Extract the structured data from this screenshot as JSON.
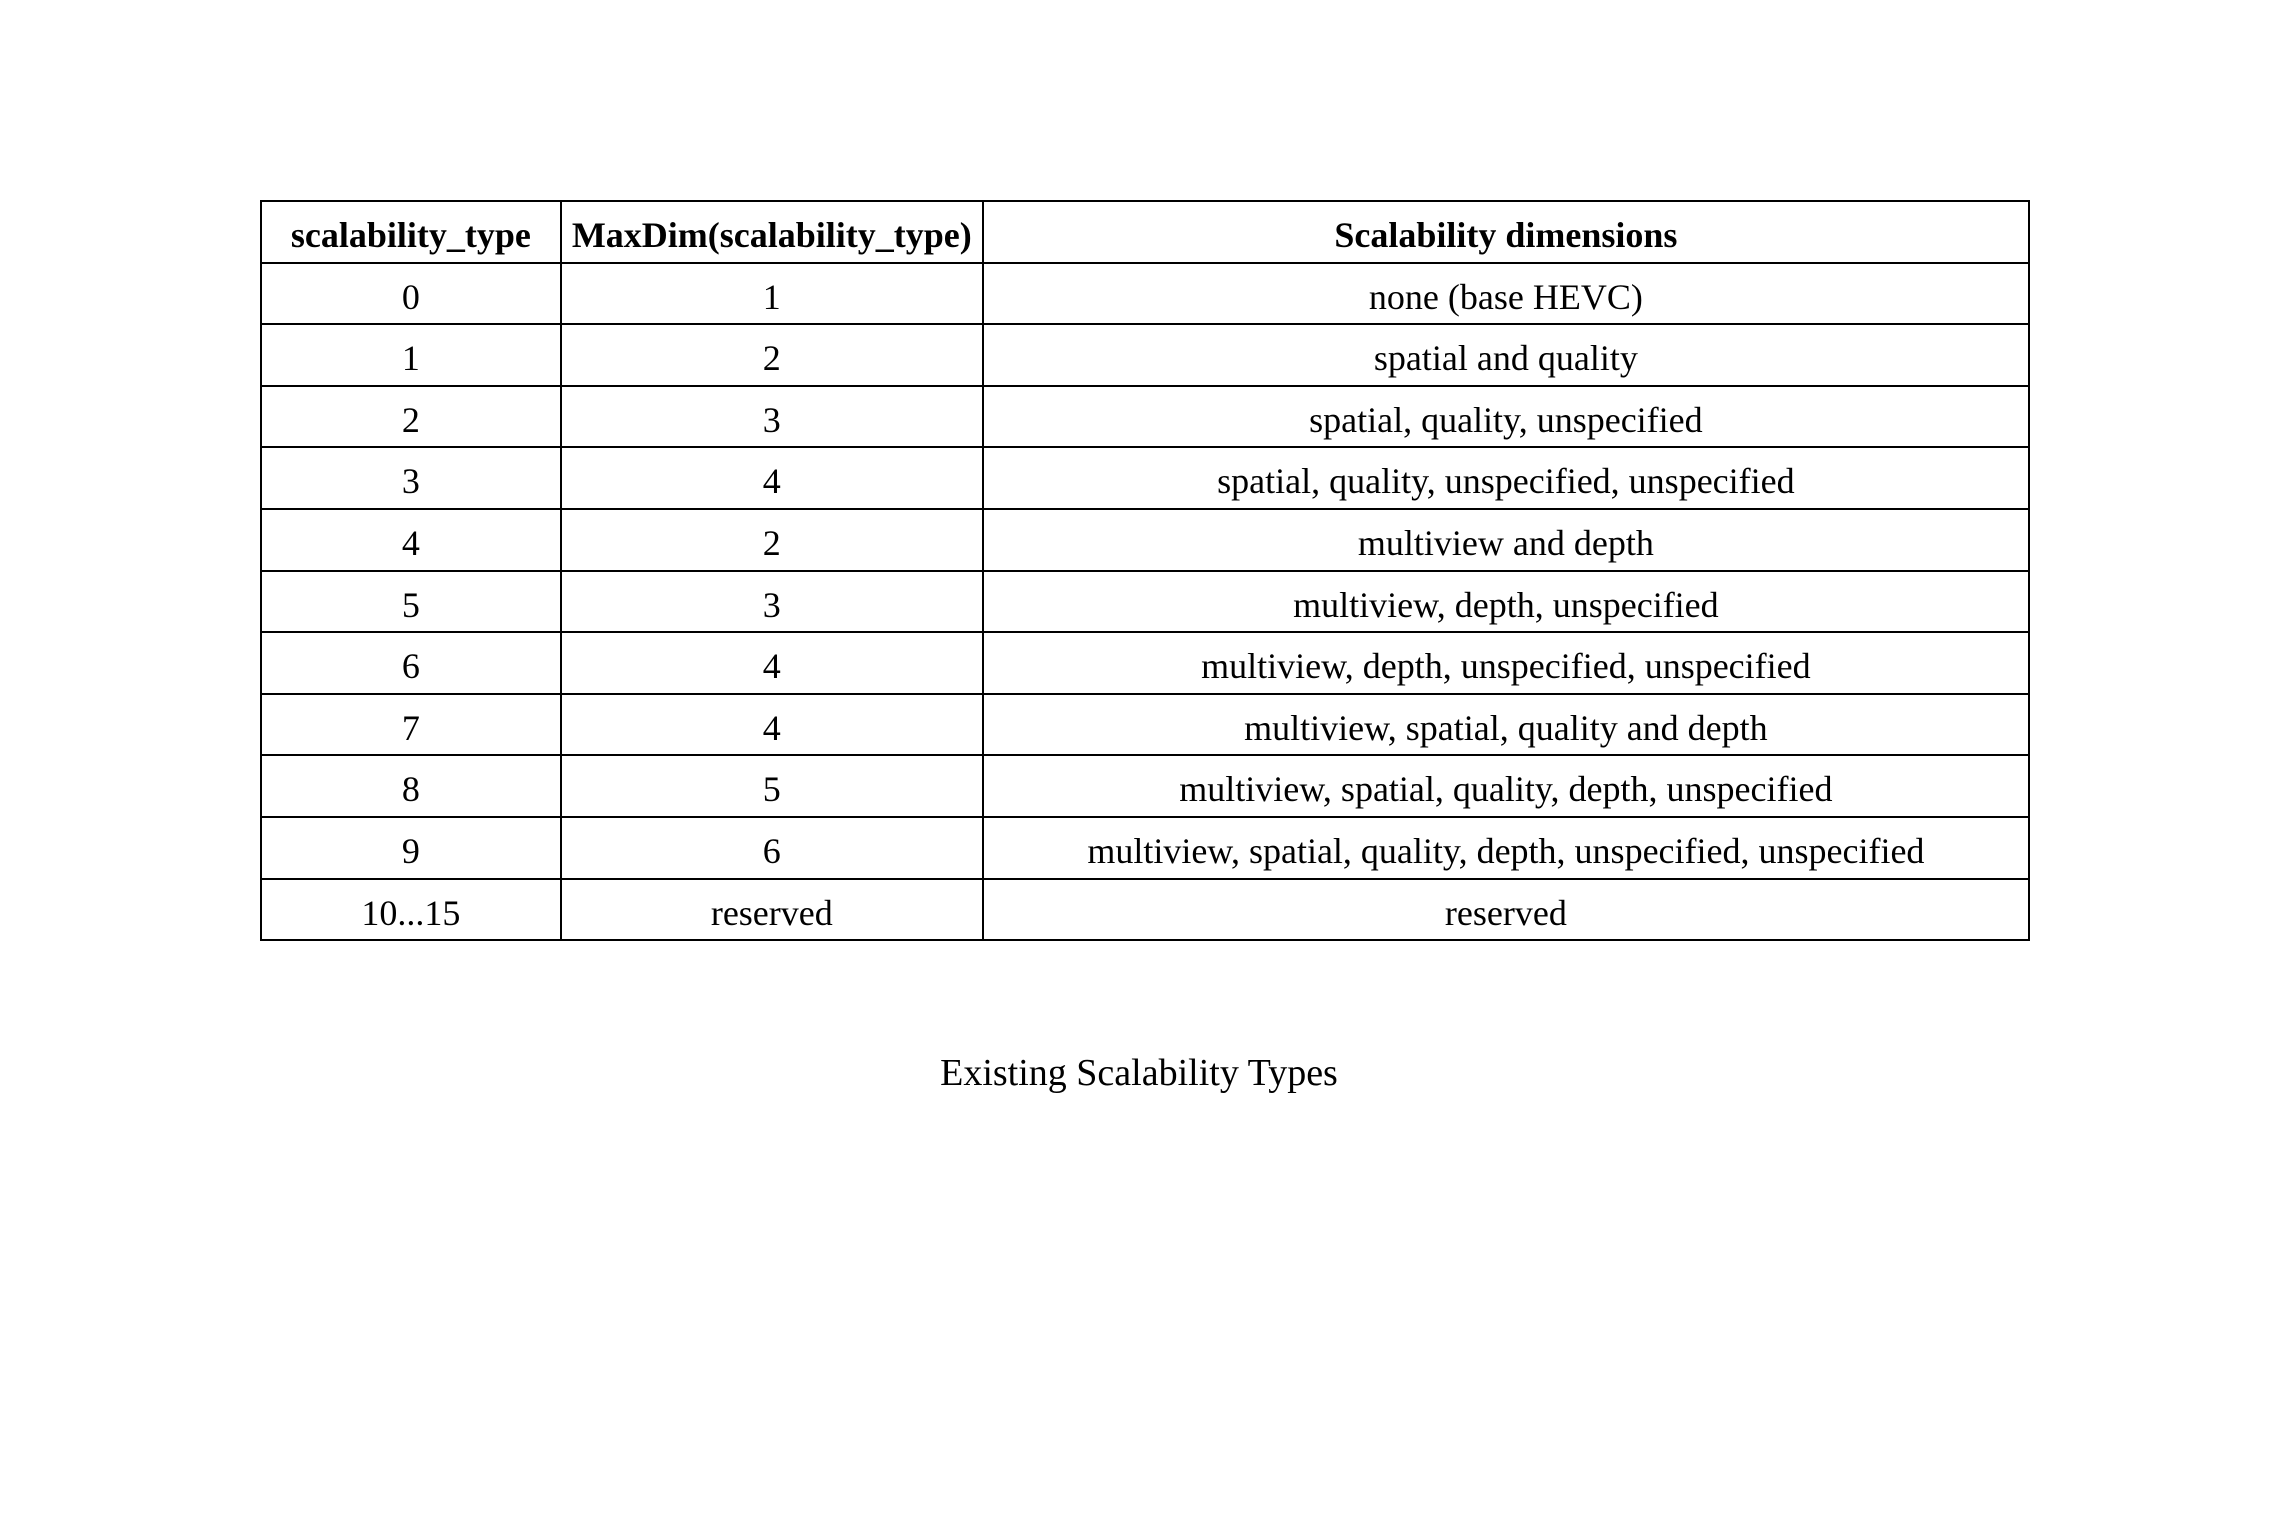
{
  "table": {
    "headers": [
      "scalability_type",
      "MaxDim(scalability_type)",
      "Scalability dimensions"
    ],
    "rows": [
      {
        "c0": "0",
        "c1": "1",
        "c2": "none (base HEVC)"
      },
      {
        "c0": "1",
        "c1": "2",
        "c2": "spatial and quality"
      },
      {
        "c0": "2",
        "c1": "3",
        "c2": "spatial, quality, unspecified"
      },
      {
        "c0": "3",
        "c1": "4",
        "c2": "spatial, quality, unspecified, unspecified"
      },
      {
        "c0": "4",
        "c1": "2",
        "c2": "multiview and depth"
      },
      {
        "c0": "5",
        "c1": "3",
        "c2": "multiview, depth, unspecified"
      },
      {
        "c0": "6",
        "c1": "4",
        "c2": "multiview, depth, unspecified, unspecified"
      },
      {
        "c0": "7",
        "c1": "4",
        "c2": "multiview, spatial, quality and depth"
      },
      {
        "c0": "8",
        "c1": "5",
        "c2": "multiview, spatial, quality, depth, unspecified"
      },
      {
        "c0": "9",
        "c1": "6",
        "c2": "multiview, spatial, quality, depth, unspecified, unspecified"
      },
      {
        "c0": "10...15",
        "c1": "reserved",
        "c2": "reserved"
      }
    ]
  },
  "caption": "Existing Scalability Types",
  "chart_data": {
    "type": "table",
    "title": "Existing Scalability Types",
    "columns": [
      "scalability_type",
      "MaxDim(scalability_type)",
      "Scalability dimensions"
    ],
    "rows": [
      [
        "0",
        "1",
        "none (base HEVC)"
      ],
      [
        "1",
        "2",
        "spatial and quality"
      ],
      [
        "2",
        "3",
        "spatial, quality, unspecified"
      ],
      [
        "3",
        "4",
        "spatial, quality, unspecified, unspecified"
      ],
      [
        "4",
        "2",
        "multiview and depth"
      ],
      [
        "5",
        "3",
        "multiview, depth, unspecified"
      ],
      [
        "6",
        "4",
        "multiview, depth, unspecified, unspecified"
      ],
      [
        "7",
        "4",
        "multiview, spatial, quality and depth"
      ],
      [
        "8",
        "5",
        "multiview, spatial, quality, depth, unspecified"
      ],
      [
        "9",
        "6",
        "multiview, spatial, quality, depth, unspecified, unspecified"
      ],
      [
        "10...15",
        "reserved",
        "reserved"
      ]
    ]
  }
}
